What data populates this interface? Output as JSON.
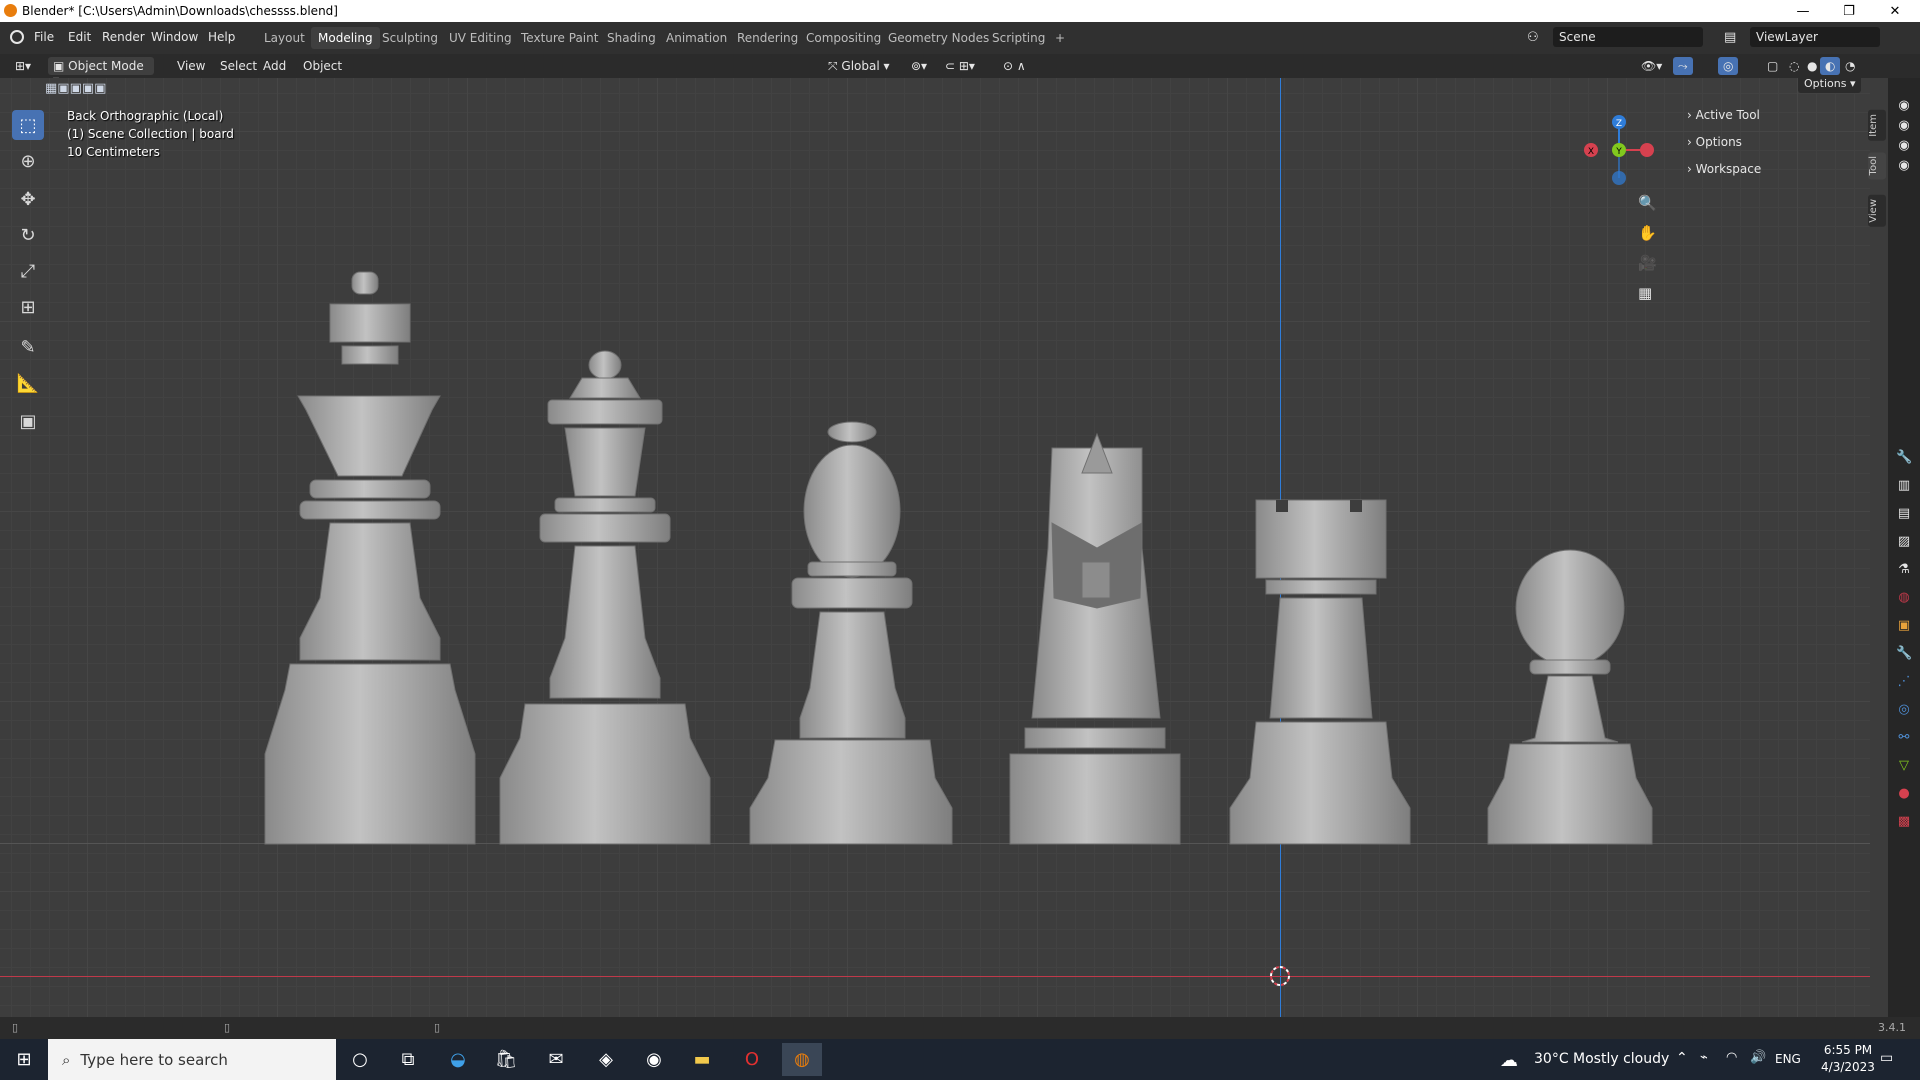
{
  "window": {
    "title": "Blender* [C:\\Users\\Admin\\Downloads\\chessss.blend]",
    "minimize": "—",
    "restore": "❐",
    "close": "✕"
  },
  "menu": [
    "File",
    "Edit",
    "Render",
    "Window",
    "Help"
  ],
  "workspaces": [
    "Layout",
    "Modeling",
    "Sculpting",
    "UV Editing",
    "Texture Paint",
    "Shading",
    "Animation",
    "Rendering",
    "Compositing",
    "Geometry Nodes",
    "Scripting",
    "+"
  ],
  "active_workspace": "Modeling",
  "scene": {
    "label": "Scene",
    "view_layer": "ViewLayer"
  },
  "header": {
    "mode": "Object Mode",
    "menus": [
      "View",
      "Select",
      "Add",
      "Object"
    ],
    "transform_orientation": "Global",
    "options": "Options"
  },
  "viewport": {
    "view_name": "Back Orthographic (Local)",
    "collection": "(1) Scene Collection | board",
    "scale": "10 Centimeters"
  },
  "gizmo": {
    "z": "Z",
    "y": "Y",
    "x": "X"
  },
  "npanel": {
    "rows": [
      "Active Tool",
      "Options",
      "Workspace"
    ],
    "tabs": [
      "Item",
      "Tool",
      "View"
    ]
  },
  "pieces": [
    "king",
    "queen",
    "bishop",
    "knight",
    "rook",
    "pawn"
  ],
  "status": {
    "version": "3.4.1"
  },
  "taskbar": {
    "search_placeholder": "Type here to search",
    "weather": "30°C  Mostly cloudy",
    "lang": "ENG",
    "time": "6:55 PM",
    "date": "4/3/2023"
  },
  "colors": {
    "accent": "#4772b3",
    "axis_x": "#d6414f",
    "axis_y": "#82c91e",
    "axis_z": "#2f7dd9",
    "piece": "#a8a8a8"
  }
}
